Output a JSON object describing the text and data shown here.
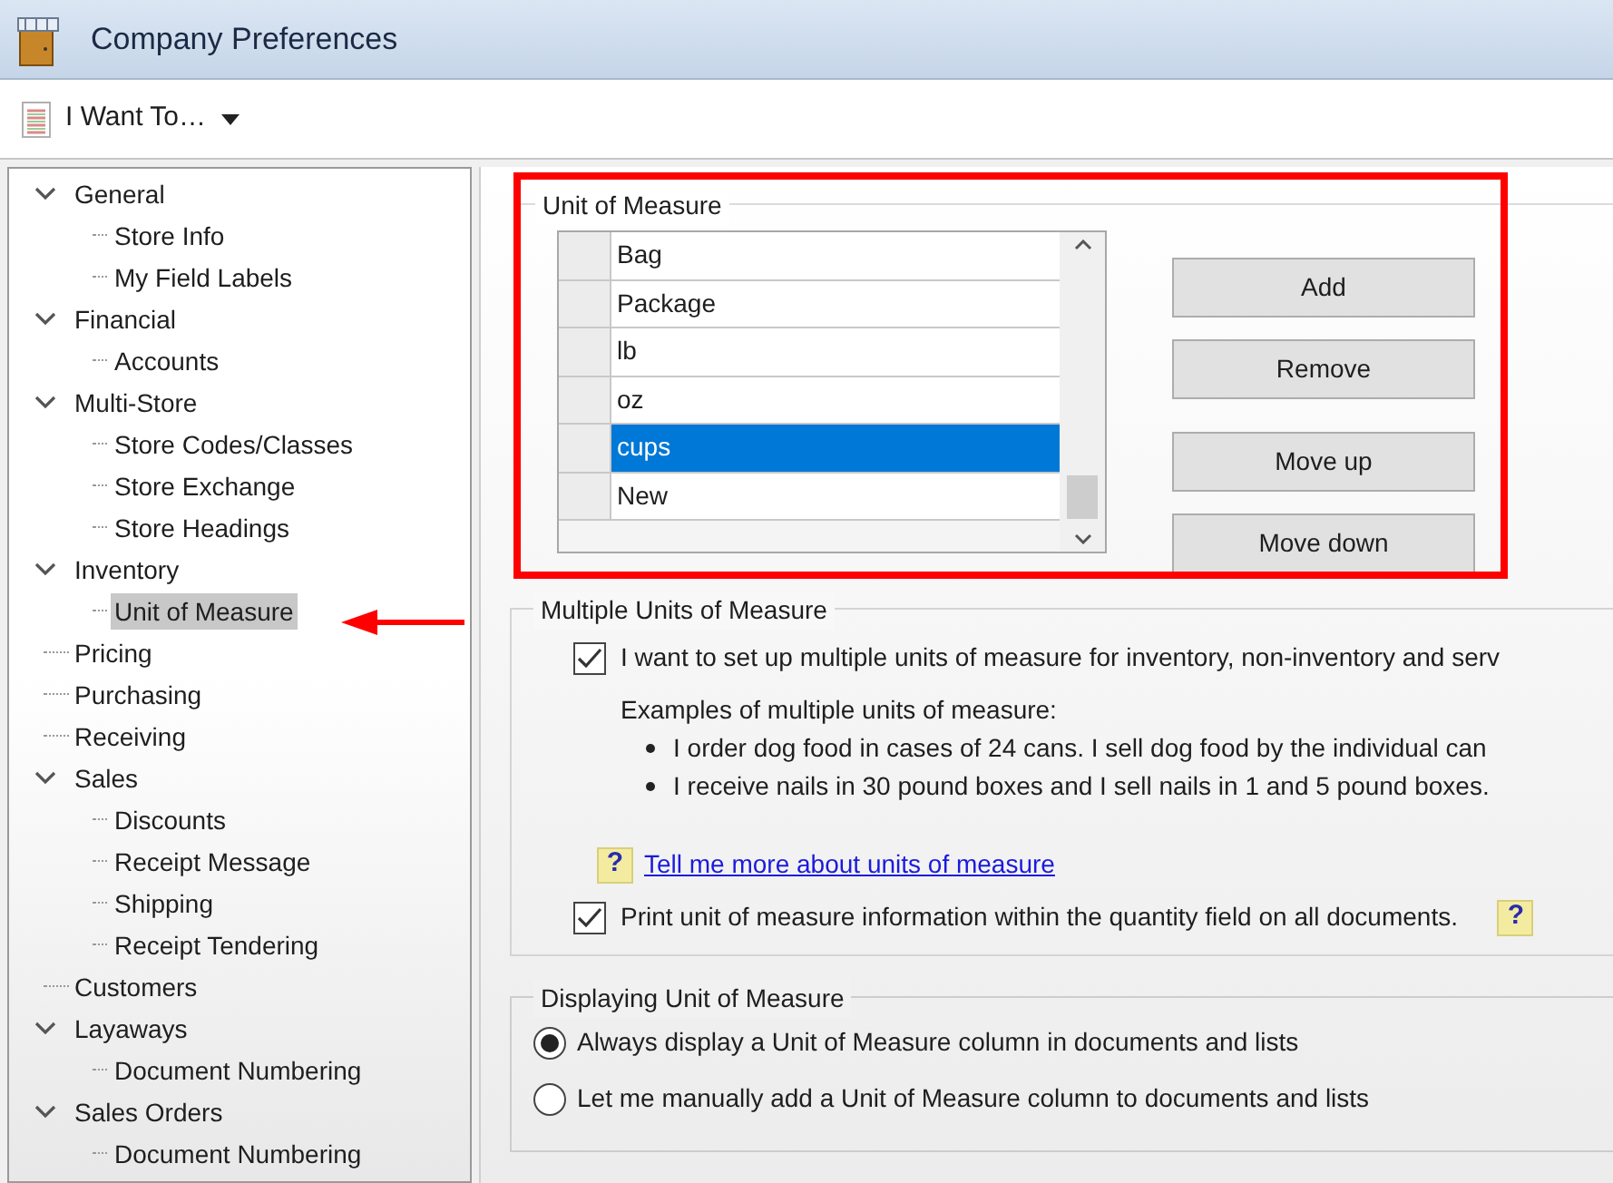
{
  "window": {
    "title": "Company Preferences"
  },
  "toolbar": {
    "menu_label": "I Want To…"
  },
  "sidebar": {
    "items": [
      {
        "label": "General",
        "expanded": true,
        "selected": false,
        "children": [
          {
            "label": "Store Info",
            "selected": false
          },
          {
            "label": "My Field Labels",
            "selected": false
          }
        ]
      },
      {
        "label": "Financial",
        "expanded": true,
        "selected": false,
        "children": [
          {
            "label": "Accounts",
            "selected": false
          }
        ]
      },
      {
        "label": "Multi-Store",
        "expanded": true,
        "selected": false,
        "children": [
          {
            "label": "Store Codes/Classes",
            "selected": false
          },
          {
            "label": "Store Exchange",
            "selected": false
          },
          {
            "label": "Store Headings",
            "selected": false
          }
        ]
      },
      {
        "label": "Inventory",
        "expanded": true,
        "selected": false,
        "children": [
          {
            "label": "Unit of Measure",
            "selected": true
          }
        ]
      },
      {
        "label": "Pricing",
        "selected": false
      },
      {
        "label": "Purchasing",
        "selected": false
      },
      {
        "label": "Receiving",
        "selected": false
      },
      {
        "label": "Sales",
        "expanded": true,
        "selected": false,
        "children": [
          {
            "label": "Discounts",
            "selected": false
          },
          {
            "label": "Receipt Message",
            "selected": false
          },
          {
            "label": "Shipping",
            "selected": false
          },
          {
            "label": "Receipt Tendering",
            "selected": false
          }
        ]
      },
      {
        "label": "Customers",
        "selected": false
      },
      {
        "label": "Layaways",
        "expanded": true,
        "selected": false,
        "children": [
          {
            "label": "Document Numbering",
            "selected": false
          }
        ]
      },
      {
        "label": "Sales Orders",
        "expanded": true,
        "selected": false,
        "children": [
          {
            "label": "Document Numbering",
            "selected": false
          }
        ]
      }
    ]
  },
  "unit_of_measure": {
    "title": "Unit of Measure",
    "units": [
      {
        "label": "Bag",
        "selected": false
      },
      {
        "label": "Package",
        "selected": false
      },
      {
        "label": "lb",
        "selected": false
      },
      {
        "label": "oz",
        "selected": false
      },
      {
        "label": "cups",
        "selected": true
      },
      {
        "label": "New",
        "selected": false
      }
    ],
    "buttons": [
      "Add",
      "Remove",
      "Move up",
      "Move down"
    ]
  },
  "multiple_units": {
    "title": "Multiple Units of Measure",
    "enable_checkbox": {
      "label": "I want to set up multiple units of measure for inventory, non-inventory and serv",
      "checked": true
    },
    "examples_heading": "Examples of multiple units of measure:",
    "examples": [
      "I order dog food in cases of 24 cans. I sell dog food by the individual can",
      "I receive nails in 30 pound boxes and I sell nails in 1 and 5 pound boxes."
    ],
    "help_icon": "?",
    "help_link": "Tell me more about units of measure",
    "print_checkbox": {
      "label": "Print unit of measure information within the quantity field on all documents.",
      "checked": true
    },
    "print_help_icon": "?"
  },
  "displaying": {
    "title": "Displaying Unit of Measure",
    "options": [
      {
        "label": "Always display a Unit of Measure column in documents and lists",
        "selected": true
      },
      {
        "label": "Let me manually add a Unit of Measure column to documents and lists",
        "selected": false
      }
    ]
  }
}
